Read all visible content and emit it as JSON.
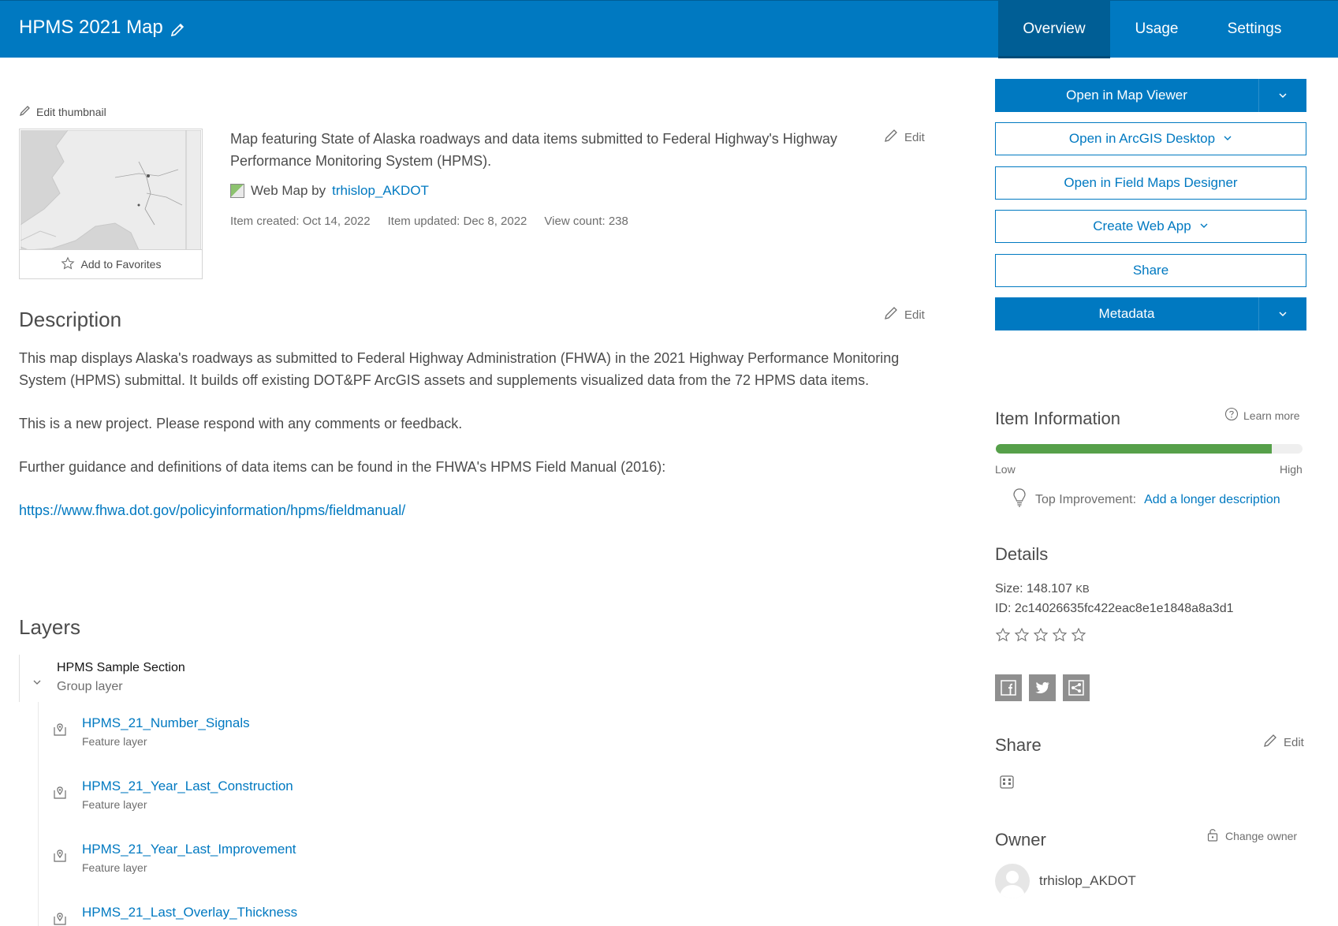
{
  "header": {
    "title": "HPMS 2021 Map",
    "tabs": [
      {
        "label": "Overview",
        "active": true
      },
      {
        "label": "Usage",
        "active": false
      },
      {
        "label": "Settings",
        "active": false
      }
    ]
  },
  "thumbnail": {
    "edit_label": "Edit thumbnail",
    "favorites_label": "Add to Favorites"
  },
  "summary": {
    "text": "Map featuring State of Alaska roadways and data items submitted to Federal Highway's Highway Performance Monitoring System (HPMS).",
    "edit_label": "Edit",
    "type_prefix": "Web Map by",
    "owner": "trhislop_AKDOT",
    "created": "Item created: Oct 14, 2022",
    "updated": "Item updated: Dec 8, 2022",
    "views": "View count: 238"
  },
  "description": {
    "heading": "Description",
    "edit_label": "Edit",
    "paragraphs": [
      "This map displays Alaska's roadways as submitted to Federal Highway Administration (FHWA) in the 2021 Highway Performance Monitoring System (HPMS) submittal. It builds off existing DOT&PF ArcGIS assets and supplements visualized data from the 72 HPMS data items.",
      "This is a new project. Please respond with any comments or feedback.",
      "Further guidance and definitions of data items can be found in the FHWA's HPMS Field Manual (2016):"
    ],
    "link": "https://www.fhwa.dot.gov/policyinformation/hpms/fieldmanual/"
  },
  "layers": {
    "heading": "Layers",
    "group": {
      "name": "HPMS Sample Section",
      "type": "Group layer"
    },
    "items": [
      {
        "name": "HPMS_21_Number_Signals",
        "type": "Feature layer"
      },
      {
        "name": "HPMS_21_Year_Last_Construction",
        "type": "Feature layer"
      },
      {
        "name": "HPMS_21_Year_Last_Improvement",
        "type": "Feature layer"
      },
      {
        "name": "HPMS_21_Last_Overlay_Thickness",
        "type": ""
      }
    ]
  },
  "actions": {
    "open_map_viewer": "Open in Map Viewer",
    "open_arcgis_desktop": "Open in ArcGIS Desktop",
    "open_field_maps": "Open in Field Maps Designer",
    "create_web_app": "Create Web App",
    "share": "Share",
    "metadata": "Metadata"
  },
  "item_information": {
    "heading": "Item Information",
    "learn_more": "Learn more",
    "score_fraction": 0.9,
    "low": "Low",
    "high": "High",
    "top_improvement_label": "Top Improvement:",
    "top_improvement_link": "Add a longer description"
  },
  "details": {
    "heading": "Details",
    "size_label": "Size: 148.107",
    "size_unit": "KB",
    "id": "ID: 2c14026635fc422eac8e1e1848a8a3d1",
    "rating_max": 5
  },
  "share": {
    "heading": "Share",
    "edit_label": "Edit"
  },
  "owner": {
    "heading": "Owner",
    "change_label": "Change owner",
    "name": "trhislop_AKDOT"
  },
  "colors": {
    "brand": "#0079c1",
    "meter": "#56a04a"
  }
}
